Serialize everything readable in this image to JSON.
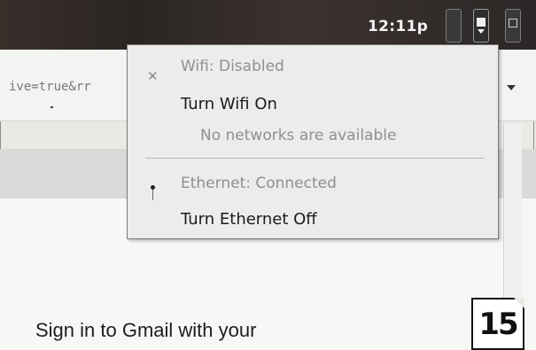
{
  "system_bar": {
    "clock": "12:11p",
    "icons": [
      "battery-icon",
      "network-icon",
      "menu-icon"
    ]
  },
  "browser": {
    "url_fragment": "ive=true&rr",
    "signin_text": "Sign in to Gmail with your"
  },
  "network_menu": {
    "wifi": {
      "status": "Wifi: Disabled",
      "action": "Turn Wifi On",
      "hint": "No networks are available"
    },
    "ethernet": {
      "status": "Ethernet: Connected",
      "action": "Turn Ethernet Off"
    }
  },
  "page_badge": "15"
}
